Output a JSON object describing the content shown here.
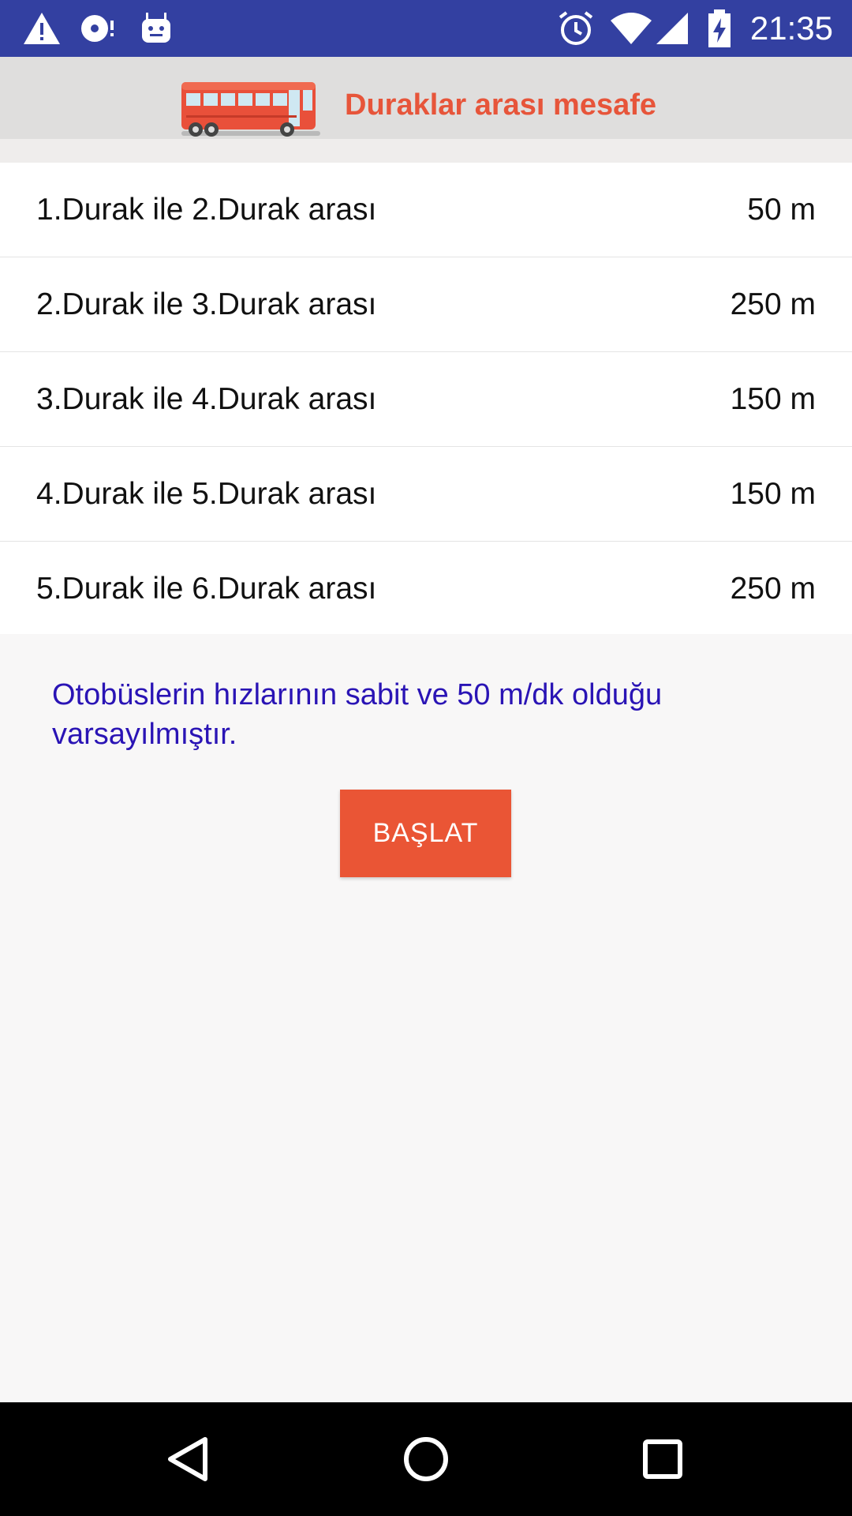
{
  "status_bar": {
    "time": "21:35",
    "icons": [
      "warning-icon",
      "disc-icon",
      "android-icon",
      "alarm-icon",
      "wifi-icon",
      "signal-icon",
      "battery-charging-icon"
    ],
    "background": "#3340a1"
  },
  "header": {
    "title": "Duraklar arası mesafe",
    "title_color": "#e7553a",
    "logo": "bus-icon"
  },
  "distances": [
    {
      "label": "1.Durak ile 2.Durak arası",
      "value": "50 m"
    },
    {
      "label": "2.Durak ile 3.Durak arası",
      "value": "250 m"
    },
    {
      "label": "3.Durak ile 4.Durak arası",
      "value": "150 m"
    },
    {
      "label": "4.Durak ile 5.Durak arası",
      "value": "150 m"
    },
    {
      "label": "5.Durak ile 6.Durak arası",
      "value": "250 m"
    }
  ],
  "note": "Otobüslerin hızlarının sabit ve 50 m/dk olduğu varsayılmıştır.",
  "note_color": "#2a14b5",
  "start_button": {
    "label": "BAŞLAT",
    "color": "#ea5535"
  },
  "nav_bar": {
    "icons": [
      "back-icon",
      "home-icon",
      "recents-icon"
    ]
  }
}
